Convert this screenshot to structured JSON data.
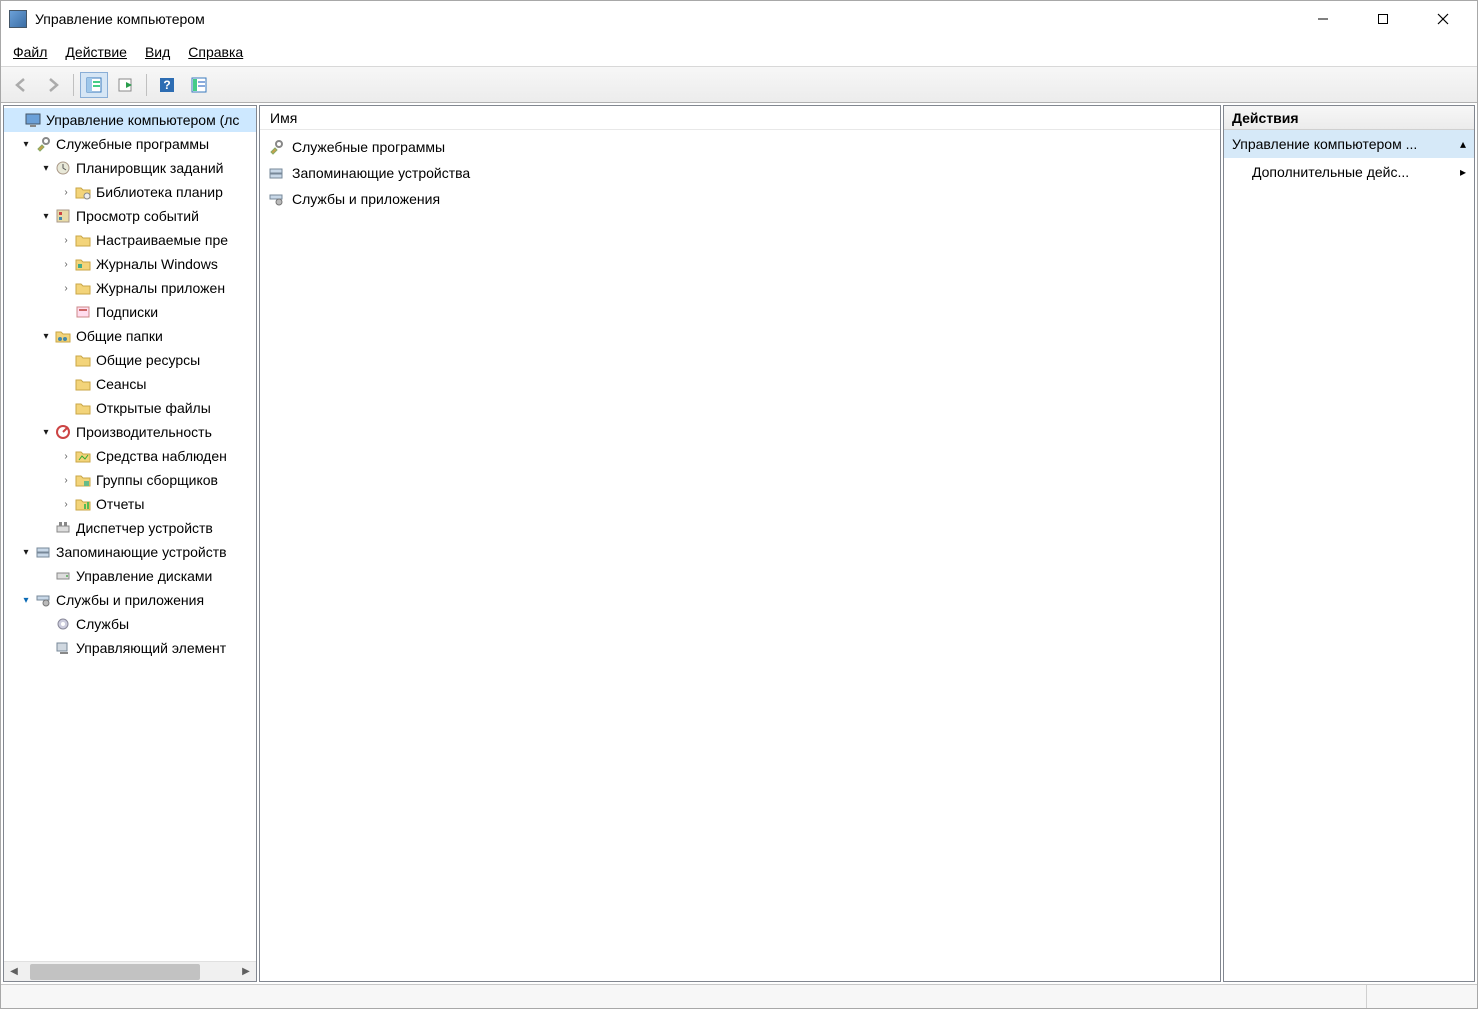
{
  "window": {
    "title": "Управление компьютером"
  },
  "menu": {
    "file": "Файл",
    "action": "Действие",
    "view": "Вид",
    "help": "Справка"
  },
  "tree": {
    "root": "Управление компьютером (лс",
    "system_tools": "Служебные программы",
    "task_scheduler": "Планировщик заданий",
    "scheduler_lib": "Библиотека планир",
    "event_viewer": "Просмотр событий",
    "custom_views": "Настраиваемые пре",
    "windows_logs": "Журналы Windows",
    "app_logs": "Журналы приложен",
    "subscriptions": "Подписки",
    "shared_folders": "Общие папки",
    "shares": "Общие ресурсы",
    "sessions": "Сеансы",
    "open_files": "Открытые файлы",
    "performance": "Производительность",
    "monitoring": "Средства наблюден",
    "collector_sets": "Группы сборщиков",
    "reports": "Отчеты",
    "device_manager": "Диспетчер устройств",
    "storage": "Запоминающие устройств",
    "disk_mgmt": "Управление дисками",
    "services_apps": "Службы и приложения",
    "services": "Службы",
    "wmi": "Управляющий элемент"
  },
  "center": {
    "header": "Имя",
    "items": [
      "Служебные программы",
      "Запоминающие устройства",
      "Службы и приложения"
    ]
  },
  "actions": {
    "header": "Действия",
    "group": "Управление компьютером ...",
    "more": "Дополнительные дейс..."
  }
}
